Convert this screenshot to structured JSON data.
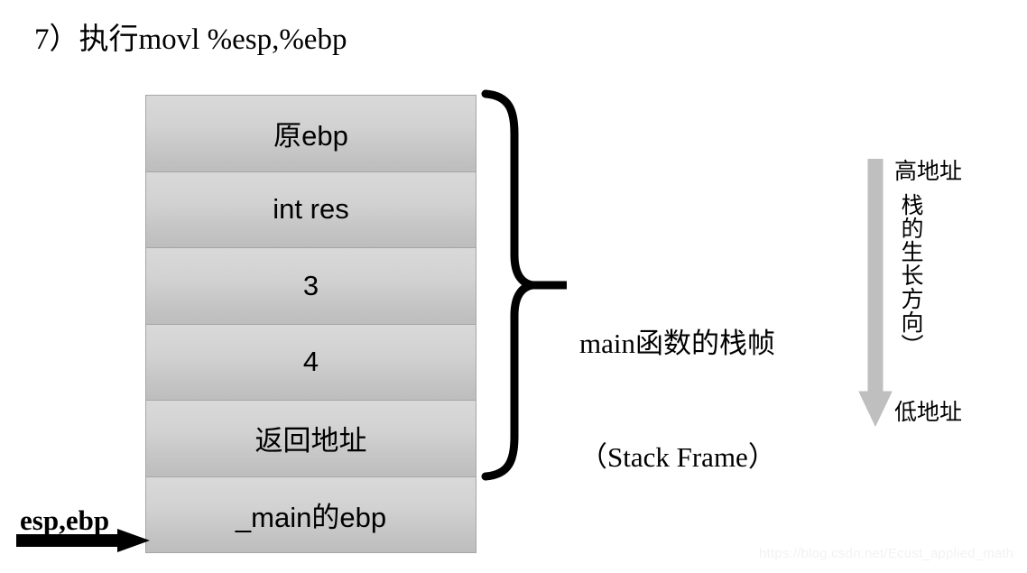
{
  "title": "7）执行movl %esp,%ebp",
  "stack": {
    "cells": [
      {
        "label": "原ebp"
      },
      {
        "label": "int res"
      },
      {
        "label": "3"
      },
      {
        "label": "4"
      },
      {
        "label": "返回地址"
      },
      {
        "label": "_main的ebp"
      }
    ]
  },
  "frame_caption": {
    "line1": "main函数的栈帧",
    "line2": "（Stack Frame）"
  },
  "address_axis": {
    "high_label": "高地址",
    "low_label": "低地址",
    "growth_label": "栈的生长方向）",
    "arrow_color": "#bfbfbf"
  },
  "pointer": {
    "label": "esp,ebp",
    "color": "#000000"
  },
  "watermark": "https://blog.csdn.net/Ecust_applied_math",
  "colors": {
    "box_fill_top": "#d9d9d9",
    "box_fill_bottom": "#bdbdbd",
    "box_border": "#a6a6a6",
    "text": "#000000",
    "background": "#ffffff"
  }
}
